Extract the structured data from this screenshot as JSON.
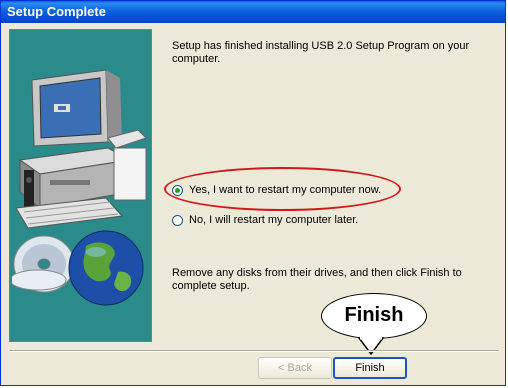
{
  "window": {
    "title": "Setup Complete"
  },
  "body": {
    "intro_line1": "Setup has finished installing USB 2.0 Setup Program on your",
    "intro_line2": "computer.",
    "option_restart_now": "Yes, I want to restart my computer now.",
    "option_restart_later": "No, I will restart my computer later.",
    "instruction_line1": "Remove any disks from their drives, and then click Finish to",
    "instruction_line2": "complete setup."
  },
  "buttons": {
    "back_label": "< Back",
    "finish_label": "Finish"
  },
  "annotation": {
    "callout_text": "Finish"
  },
  "colors": {
    "titlebar": "#0a5fd8",
    "art_background": "#2b8a8a",
    "highlight": "#d21919"
  },
  "icons": [
    "computer-illustration",
    "cd-disc-icon",
    "globe-icon"
  ]
}
